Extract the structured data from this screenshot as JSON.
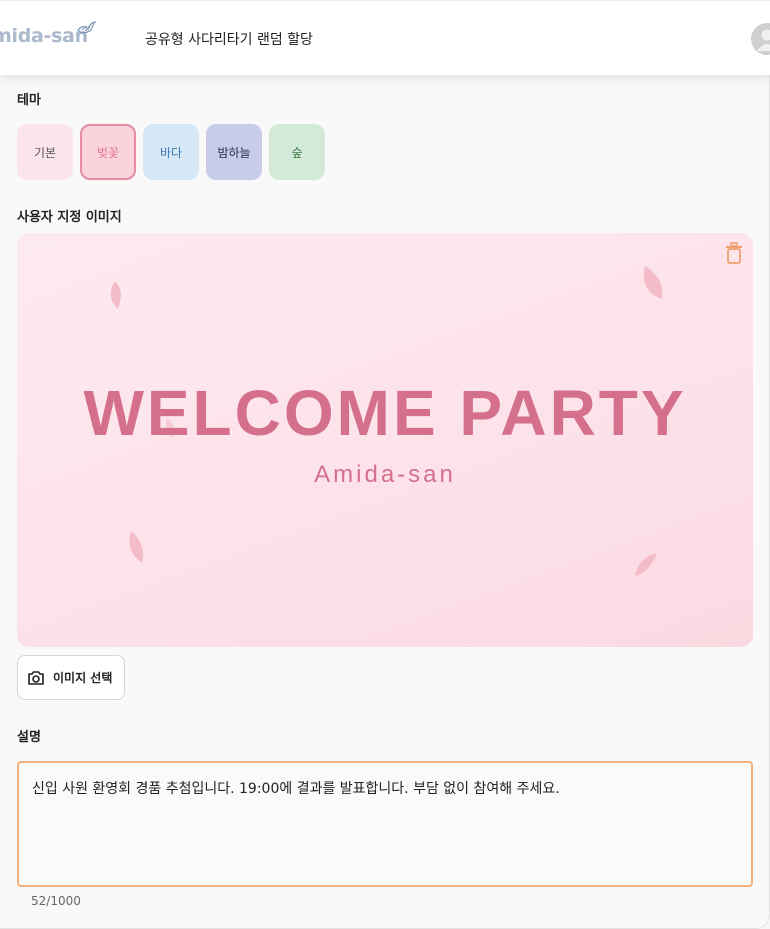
{
  "header": {
    "logo_text": "mida-san",
    "app_title": "공유형 사다리타기 랜덤 할당"
  },
  "theme": {
    "label": "테마",
    "options": [
      {
        "label": "기본",
        "bg": "#fbe4ea",
        "text": "#555555",
        "selected": false
      },
      {
        "label": "벚꽃",
        "bg": "#fbd3dd",
        "text": "#e07792",
        "selected": true
      },
      {
        "label": "바다",
        "bg": "#d6e8f5",
        "text": "#3d7bb3",
        "selected": false
      },
      {
        "label": "밤하늘",
        "bg": "#c9cce8",
        "text": "#2c2f55",
        "selected": false
      },
      {
        "label": "숲",
        "bg": "#d4ead9",
        "text": "#3a7a48",
        "selected": false
      }
    ]
  },
  "custom_image": {
    "label": "사용자 지정 이미지",
    "banner_title": "WELCOME PARTY",
    "banner_subtitle": "Amida-san",
    "select_button": "이미지 선택"
  },
  "description": {
    "label": "설명",
    "value": "신입 사원 환영회 경품 추첨입니다. 19:00에 결과를 발표합니다. 부담 없이 참여해 주세요.",
    "counter": "52/1000"
  },
  "colors": {
    "accent_border": "#f5b07a",
    "banner_text": "#d46f8e",
    "trash_icon": "#f0a070"
  }
}
